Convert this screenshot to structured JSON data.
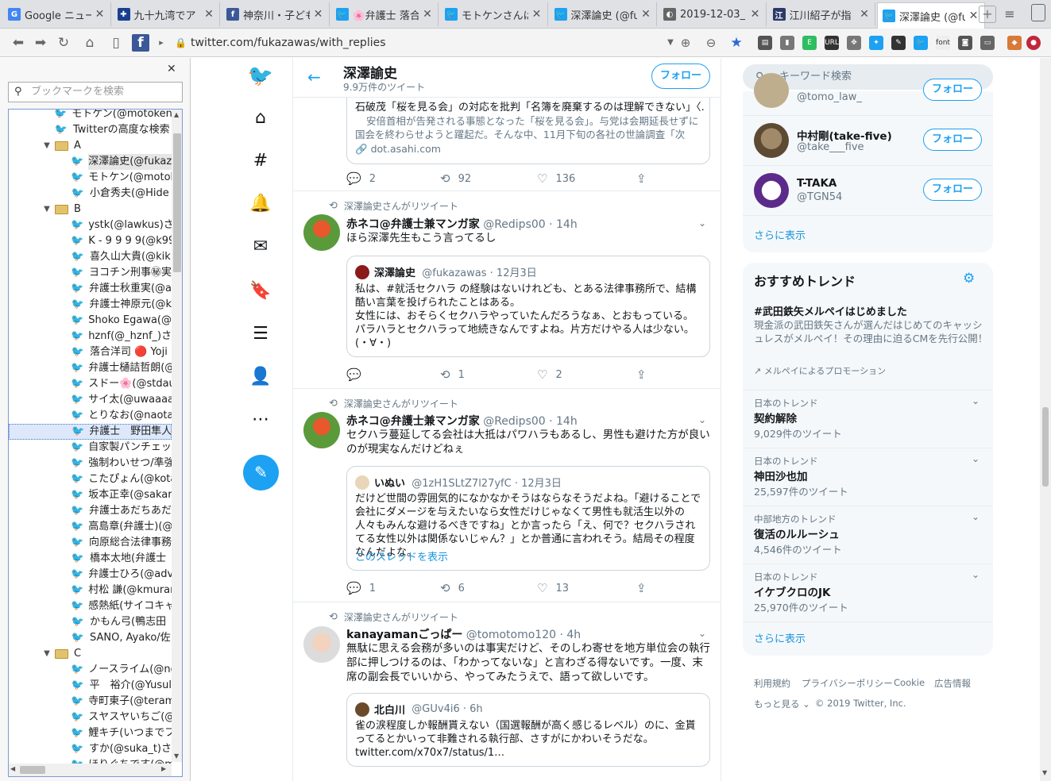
{
  "browser": {
    "tabs": [
      {
        "title": "Google ニュー",
        "fav_color": "#4285f4",
        "fav_text": "G"
      },
      {
        "title": "九十九湾でア",
        "fav_color": "#1a3f8f",
        "fav_text": "✚"
      },
      {
        "title": "神奈川・子ども",
        "fav_color": "#3b5998",
        "fav_text": "f"
      },
      {
        "title": "🌸弁護士 落合",
        "fav_color": "#1da1f2",
        "fav_text": "🐦"
      },
      {
        "title": "モトケンさんは",
        "fav_color": "#1da1f2",
        "fav_text": "🐦"
      },
      {
        "title": "深澤論史 (@fu",
        "fav_color": "#1da1f2",
        "fav_text": "🐦"
      },
      {
        "title": "2019-12-03_",
        "fav_color": "#666666",
        "fav_text": "◐"
      },
      {
        "title": "江川紹子が指",
        "fav_color": "#2b3a67",
        "fav_text": "江"
      },
      {
        "title": "深澤論史 (@fu",
        "fav_color": "#1da1f2",
        "fav_text": "🐦"
      }
    ],
    "url": "twitter.com/fukazawas/with_replies"
  },
  "bookmarks": {
    "search_placeholder": "ブックマークを検索",
    "rows": [
      {
        "label": "モトケン(@motoken_",
        "kind": "link",
        "indent": 1
      },
      {
        "label": "Twitterの高度な検索",
        "kind": "link",
        "indent": 1
      },
      {
        "label": "A",
        "kind": "folder",
        "indent": 0
      },
      {
        "label": "深澤論史(@fukaz",
        "kind": "link",
        "indent": 2,
        "selected": true
      },
      {
        "label": "モトケン(@motok",
        "kind": "link",
        "indent": 2
      },
      {
        "label": "小倉秀夫(@Hide",
        "kind": "link",
        "indent": 2
      },
      {
        "label": "B",
        "kind": "folder",
        "indent": 0
      },
      {
        "label": "ystk(@lawkus)さ",
        "kind": "link",
        "indent": 2
      },
      {
        "label": "K - 9 9 9 9(@k99",
        "kind": "link",
        "indent": 2
      },
      {
        "label": "喜久山大貴(@kik",
        "kind": "link",
        "indent": 2
      },
      {
        "label": "ヨコチン刑事㊙実",
        "kind": "link",
        "indent": 2
      },
      {
        "label": "弁護士秋重実(@a",
        "kind": "link",
        "indent": 2
      },
      {
        "label": "弁護士神原元(@k",
        "kind": "link",
        "indent": 2
      },
      {
        "label": "Shoko Egawa(@",
        "kind": "link",
        "indent": 2
      },
      {
        "label": "hznf(@_hznf_)さ",
        "kind": "link",
        "indent": 2
      },
      {
        "label": "落合洋司 🔴 Yoji",
        "kind": "link",
        "indent": 2
      },
      {
        "label": "弁護士樋詰哲朗(@",
        "kind": "link",
        "indent": 2
      },
      {
        "label": "スドー🌸(@stdau",
        "kind": "link",
        "indent": 2
      },
      {
        "label": "サイ太(@uwaaaa)",
        "kind": "link",
        "indent": 2
      },
      {
        "label": "とりなお(@naotar",
        "kind": "link",
        "indent": 2
      },
      {
        "label": "弁護士　野田隼人",
        "kind": "link",
        "indent": 2,
        "selected": true,
        "focus": true
      },
      {
        "label": "自家製パンチェッタ",
        "kind": "link",
        "indent": 2
      },
      {
        "label": "強制わいせつ/準強",
        "kind": "link",
        "indent": 2
      },
      {
        "label": "こたぴょん(@kota",
        "kind": "link",
        "indent": 2
      },
      {
        "label": "坂本正幸(@sakar",
        "kind": "link",
        "indent": 2
      },
      {
        "label": "弁護士あだちあだ",
        "kind": "link",
        "indent": 2
      },
      {
        "label": "高島章(弁護士)(@",
        "kind": "link",
        "indent": 2
      },
      {
        "label": "向原総合法律事務",
        "kind": "link",
        "indent": 2
      },
      {
        "label": "橋本太地(弁護士",
        "kind": "link",
        "indent": 2
      },
      {
        "label": "弁護士ひろ(@adv",
        "kind": "link",
        "indent": 2
      },
      {
        "label": "村松 謙(@kmurar",
        "kind": "link",
        "indent": 2
      },
      {
        "label": "感熱紙(サイコキャ",
        "kind": "link",
        "indent": 2
      },
      {
        "label": "かもん弓(鴨志田",
        "kind": "link",
        "indent": 2
      },
      {
        "label": "SANO, Ayako/佐",
        "kind": "link",
        "indent": 2
      },
      {
        "label": "C",
        "kind": "folder",
        "indent": 0
      },
      {
        "label": "ノースライム(@no",
        "kind": "link",
        "indent": 2
      },
      {
        "label": "平　裕介(@Yusul",
        "kind": "link",
        "indent": 2
      },
      {
        "label": "寺町東子(@teram",
        "kind": "link",
        "indent": 2
      },
      {
        "label": "スヤスヤいちご(@",
        "kind": "link",
        "indent": 2
      },
      {
        "label": "鯉キチ(いつまでフ",
        "kind": "link",
        "indent": 2
      },
      {
        "label": "すか(@suka_t)さ",
        "kind": "link",
        "indent": 2
      },
      {
        "label": "ほりぐちです(@m",
        "kind": "link",
        "indent": 2
      }
    ]
  },
  "profile": {
    "name": "深澤諭史",
    "tweet_count": "9.9万件のツイート",
    "follow_label": "フォロー"
  },
  "tweets": [
    {
      "id": "t0",
      "card_title": "石破茂「桜を見る会」の対応を批判「名簿を廃棄するのは理解できない」〈…",
      "card_desc": "安倍首相が告発される事態となった「桜を見る会」。与党は会期延長せずに国会を終わらせようと躍起だ。そんな中、11月下旬の各社の世論調査「次の…",
      "card_link": "dot.asahi.com",
      "reply": "2",
      "retweet": "92",
      "like": "136"
    },
    {
      "id": "t1",
      "rt_label": "深澤論史さんがリツイート",
      "name": "赤ネコ@弁護士兼マンガ家",
      "handle": "@Redips00 · 14h",
      "text": "ほら深澤先生もこう言ってるし",
      "quote_name": "深澤論史",
      "quote_handle": "@fukazawas · 12月3日",
      "quote_text": "私は、#就活セクハラ の経験はないけれども、とある法律事務所で、結構酷い言葉を投げられたことはある。\n女性には、おそらくセクハラやっていたんだろうなぁ、とおもっている。\nパラハラとセクハラって地続きなんですよね。片方だけやる人は少ない。\n(・∀・)",
      "reply": "",
      "retweet": "1",
      "like": "2"
    },
    {
      "id": "t2",
      "rt_label": "深澤論史さんがリツイート",
      "name": "赤ネコ@弁護士兼マンガ家",
      "handle": "@Redips00 · 14h",
      "text": "セクハラ蔓延してる会社は大抵はパワハラもあるし、男性も避けた方が良いのが現実なんだけどねぇ",
      "quote_name": "いぬい",
      "quote_handle": "@1zH1SLtZ7l27yfC · 12月3日",
      "quote_text": "だけど世間の雰囲気的になかなかそうはならなそうだよね。「避けることで会社にダメージを与えたいなら女性だけじゃなくて男性も就活生以外の人々もみんな避けるべきですね」とか言ったら「え、何で？セクハラされてる女性以外は関係ないじゃん？」とか普通に言われそう。結局その程度なんだよな。",
      "quote_link": "このスレッドを表示",
      "reply": "1",
      "retweet": "6",
      "like": "13"
    },
    {
      "id": "t3",
      "rt_label": "深澤論史さんがリツイート",
      "name": "kanayamanごっぱー",
      "handle": "@tomotomo120 · 4h",
      "text": "無駄に思える会務が多いのは事実だけど、そのしわ寄せを地方単位会の執行部に押しつけるのは、「わかってないな」と言わざる得ないです。一度、末席の副会長でいいから、やってみたうえで、語って欲しいです。",
      "quote_name": "北白川",
      "quote_handle": "@GUv4i6 · 6h",
      "quote_text": "雀の涙程度しか報酬貰えない（国選報酬が高く感じるレベル）のに、金貰ってるとかいって非難される執行部、さすがにかわいそうだな。\ntwitter.com/x70x7/status/1…"
    }
  ],
  "right": {
    "search_placeholder": "キーワード検索",
    "who_to_follow": [
      {
        "name": "",
        "handle": "@tomo_law_",
        "color": "#bfae8e"
      },
      {
        "name": "中村剛(take-five)",
        "handle": "@take___five",
        "color": "#8a7a5a"
      },
      {
        "name": "T-TAKA",
        "handle": "@TGN54",
        "color": "#5b2a8a"
      }
    ],
    "follow_label": "フォロー",
    "show_more": "さらに表示",
    "trends_title": "おすすめトレンド",
    "promoted": {
      "name": "#武田鉄矢メルペイはじめました",
      "desc": "現金派の武田鉄矢さんが選んだはじめてのキャッシュレスがメルペイ！その理由に迫るCMを先行公開！",
      "by": "メルペイによるプロモーション"
    },
    "trends": [
      {
        "context": "日本のトレンド",
        "name": "契約解除",
        "count": "9,029件のツイート"
      },
      {
        "context": "日本のトレンド",
        "name": "神田沙也加",
        "count": "25,597件のツイート"
      },
      {
        "context": "中部地方のトレンド",
        "name": "復活のルルーシュ",
        "count": "4,546件のツイート"
      },
      {
        "context": "日本のトレンド",
        "name": "イケブクロのJK",
        "count": "25,970件のツイート"
      }
    ],
    "footer": {
      "terms": "利用規約",
      "privacy": "プライバシーポリシー",
      "cookie": "Cookie",
      "ads": "広告情報",
      "more": "もっと見る",
      "copyright": "© 2019 Twitter, Inc."
    }
  }
}
